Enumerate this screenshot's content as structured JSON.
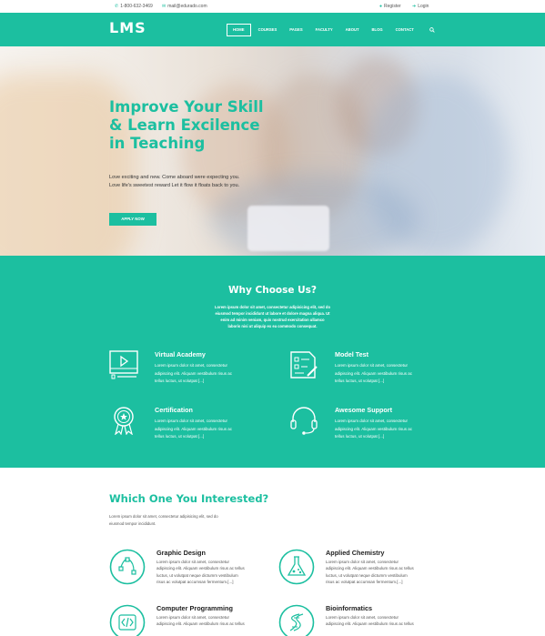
{
  "colors": {
    "accent": "#1cbfa0",
    "text": "#333333",
    "white": "#ffffff"
  },
  "topbar": {
    "phone": "1-800-632-3469",
    "email": "mail@edurado.com",
    "register": "Register",
    "login": "Login",
    "icons": [
      "phone-icon",
      "mail-icon",
      "user-icon",
      "login-icon"
    ]
  },
  "header": {
    "logo": "LMS",
    "nav": [
      "HOME",
      "COURSES",
      "PAGES",
      "FACULTY",
      "ABOUT",
      "BLOG",
      "CONTACT"
    ],
    "active_nav": "HOME"
  },
  "hero": {
    "title_lines": [
      "Improve Your Skill",
      "& Learn Excilence",
      "in Teaching"
    ],
    "text_lines": [
      "Love exciting and new. Come aboard were expecting you.",
      "Love life's sweetest reward Let it flow it floats back to you."
    ],
    "button": "APPLY NOW"
  },
  "why": {
    "title": "Why Choose Us?",
    "desc_lines": [
      "Lorem ipsum dolor sit amet, consectetur adipisicing elit, sed do",
      "eiusmod tempor incididunt ut labore et dolore magna aliqua. Ut",
      "enim ad minim veniam, quis nostrud exercitation ullamco",
      "laboris nisi ut aliquip ex ea commodo consequat."
    ],
    "features": [
      {
        "title": "Virtual Academy",
        "icon": "video-player-icon",
        "desc_lines": [
          "Lorem ipsum dolor sit amet, consectetur",
          "adipiscing elit. Aliquam vestibulum risus ac",
          "tellus luctus, ut volutpat [...]"
        ]
      },
      {
        "title": "Model Test",
        "icon": "checklist-icon",
        "desc_lines": [
          "Lorem ipsum dolor sit amet, consectetur",
          "adipiscing elit. Aliquam vestibulum risus ac",
          "tellus luctus, ut volutpat [...]"
        ]
      },
      {
        "title": "Certification",
        "icon": "award-icon",
        "desc_lines": [
          "Lorem ipsum dolor sit amet, consectetur",
          "adipiscing elit. Aliquam vestibulum risus ac",
          "tellus luctus, ut volutpat [...]"
        ]
      },
      {
        "title": "Awesome Support",
        "icon": "headset-icon",
        "desc_lines": [
          "Lorem ipsum dolor sit amet, consectetur",
          "adipiscing elit. Aliquam vestibulum risus ac",
          "tellus luctus, ut volutpat [...]"
        ]
      }
    ]
  },
  "interested": {
    "title": "Which One You Interested?",
    "desc_lines": [
      "Lorem ipsum dolor sit amet, consectetur adipisicing elit, sed do",
      "eiusmod tempor incididunt."
    ],
    "courses": [
      {
        "title": "Graphic Design",
        "icon": "vector-pen-icon",
        "desc_lines": [
          "Lorem ipsum dolor sit amet, consectetur",
          "adipiscing elit. Aliquam vestibulum risus ac tellus",
          "luctus, ut volutpat neque dictumm vestibulum",
          "risus ac volutpat accumsan fermentum.[...]"
        ]
      },
      {
        "title": "Applied Chemistry",
        "icon": "flask-icon",
        "desc_lines": [
          "Lorem ipsum dolor sit amet, consectetur",
          "adipiscing elit. Aliquam vestibulum risus ac tellus",
          "luctus, ut volutpat neque dictumm vestibulum",
          "risus ac volutpat accumsan fermentum.[...]"
        ]
      },
      {
        "title": "Computer Programming",
        "icon": "code-icon",
        "desc_lines": [
          "Lorem ipsum dolor sit amet, consectetur",
          "adipiscing elit. Aliquam vestibulum risus ac tellus"
        ]
      },
      {
        "title": "Bioinformatics",
        "icon": "dna-icon",
        "desc_lines": [
          "Lorem ipsum dolor sit amet, consectetur",
          "adipiscing elit. Aliquam vestibulum risus ac tellus"
        ]
      }
    ]
  }
}
